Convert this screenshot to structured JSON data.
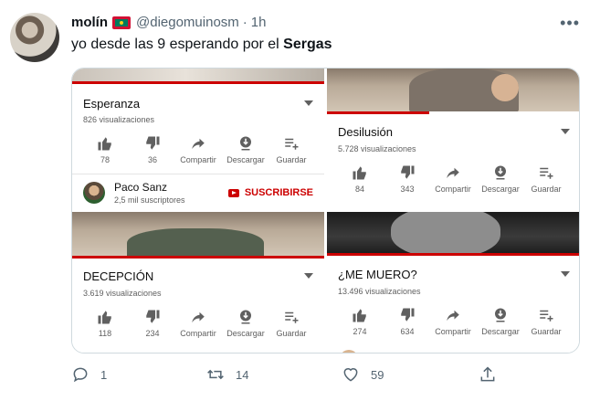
{
  "tweet": {
    "author_name": "molín",
    "handle": "@diegomuinosm",
    "separator": "·",
    "time": "1h",
    "text_prefix": "yo desde las 9 esperando por el ",
    "text_bold": "Sergas",
    "more_icon": "more-dots-icon"
  },
  "videos": {
    "top_left": {
      "title": "Esperanza",
      "views": "826 visualizaciones",
      "likes": "78",
      "dislikes": "36",
      "share": "Compartir",
      "download": "Descargar",
      "save": "Guardar"
    },
    "channel": {
      "name": "Paco Sanz",
      "subs": "2,5 mil suscriptores",
      "subscribe": "SUSCRIBIRSE"
    },
    "top_right": {
      "title": "Desilusión",
      "views": "5.728 visualizaciones",
      "likes": "84",
      "dislikes": "343",
      "share": "Compartir",
      "download": "Descargar",
      "save": "Guardar"
    },
    "bottom_left": {
      "title": "DECEPCIÓN",
      "views": "3.619 visualizaciones",
      "likes": "118",
      "dislikes": "234",
      "share": "Compartir",
      "download": "Descargar",
      "save": "Guardar"
    },
    "bottom_right": {
      "title": "¿ME MUERO?",
      "views": "13.496 visualizaciones",
      "likes": "274",
      "dislikes": "634",
      "share": "Compartir",
      "download": "Descargar",
      "save": "Guardar"
    }
  },
  "actions": {
    "replies": "1",
    "retweets": "14",
    "likes": "59"
  },
  "colors": {
    "youtube_red": "#cc0000",
    "twitter_gray": "#536471"
  }
}
